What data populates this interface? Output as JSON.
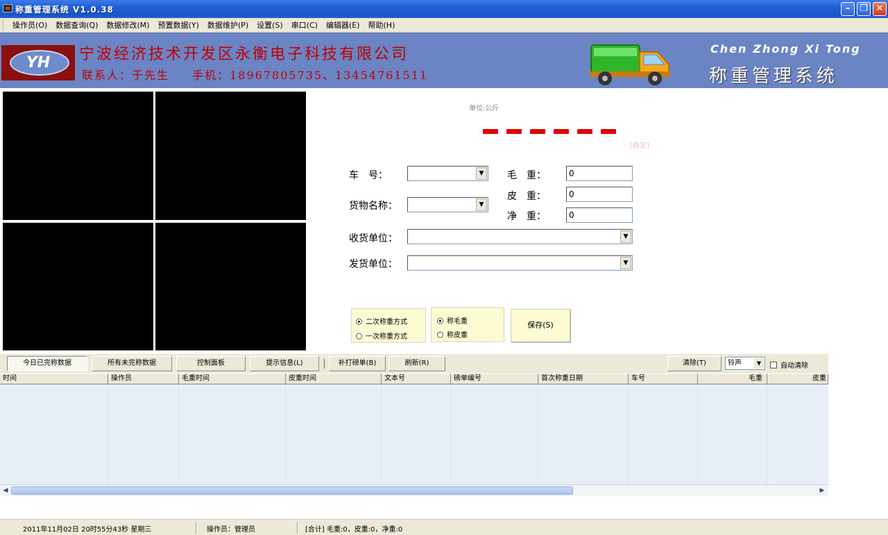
{
  "window": {
    "title": "称重管理系统 V1.0.38"
  },
  "menu": [
    "操作员(O)",
    "数据查询(Q)",
    "数据修改(M)",
    "预置数据(Y)",
    "数据维护(P)",
    "设置(S)",
    "串口(C)",
    "编辑器(E)",
    "帮助(H)"
  ],
  "banner": {
    "logo_text": "YH",
    "company": "宁波经济技术开发区永衡电子科技有限公司",
    "contact_person": "联系人：于先生",
    "contact_phone": "手机：18967805735、13454761511",
    "pinyin": [
      "Chen",
      "Zhong",
      "Xi",
      "Tong"
    ],
    "system_name": "称重管理系统"
  },
  "display": {
    "unit": "单位:公斤",
    "stable": "[稳定]"
  },
  "form": {
    "plate_label": "车　号：",
    "goods_label": "货物名称：",
    "receiver_label": "收货单位：",
    "shipper_label": "发货单位：",
    "gross_label": "毛　重：",
    "tare_label": "皮　重：",
    "net_label": "净　重：",
    "gross_value": "0",
    "tare_value": "0",
    "net_value": "0"
  },
  "options": {
    "mode_two": "二次称重方式",
    "mode_one": "一次称重方式",
    "weigh_gross": "称毛重",
    "weigh_tare": "称皮重",
    "save": "保存(S)"
  },
  "toolbar": {
    "today": "今日已完称数据",
    "unfinished": "所有未完称数据",
    "control": "控制面板",
    "notice": "提示信息(L)",
    "reprint": "补打磅单(B)",
    "refresh": "刷新(R)",
    "clear": "清除(T)",
    "sound": "铃声",
    "auto_clear": "自动清除"
  },
  "grid": {
    "columns": [
      "时间",
      "操作员",
      "毛重时间",
      "皮重时间",
      "文本号",
      "磅单编号",
      "首次称重日期",
      "车号",
      "毛重",
      "皮重"
    ]
  },
  "status": {
    "datetime": "2011年11月02日 20时55分43秒 星期三",
    "operator": "操作员：管理员",
    "totals": "[合计] 毛重:0，皮重:0，净重:0"
  }
}
